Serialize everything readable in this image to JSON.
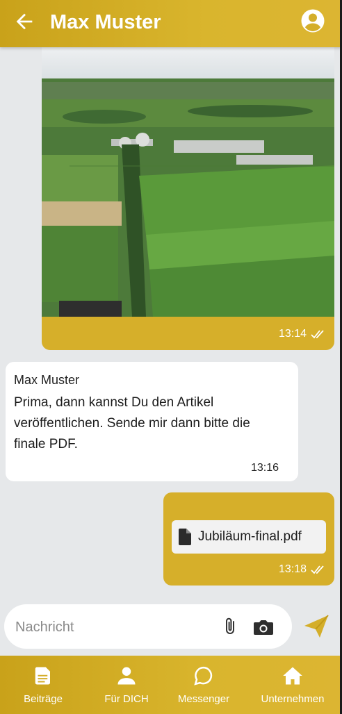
{
  "header": {
    "title": "Max Muster",
    "back_icon": "arrow-left-icon",
    "profile_icon": "account-circle-icon",
    "accent_color": "#d4ae2a"
  },
  "messages": [
    {
      "direction": "outgoing",
      "type": "image",
      "image_description_icon": "aerial-farm-photo",
      "time": "13:14",
      "status_icon": "double-check-icon"
    },
    {
      "direction": "incoming",
      "type": "text",
      "sender": "Max Muster",
      "text": "Prima, dann kannst Du den Artikel veröffentlichen. Sende mir dann bitte die finale PDF.",
      "time": "13:16"
    },
    {
      "direction": "outgoing",
      "type": "file",
      "file_icon": "document-icon",
      "file_name": "Jubiläum-final.pdf",
      "time": "13:18",
      "status_icon": "double-check-icon"
    }
  ],
  "composer": {
    "placeholder": "Nachricht",
    "value": "",
    "attach_icon": "paperclip-icon",
    "camera_icon": "camera-icon",
    "send_icon": "send-icon"
  },
  "bottom_nav": {
    "items": [
      {
        "label": "Beiträge",
        "icon": "article-icon"
      },
      {
        "label": "Für DICH",
        "icon": "person-icon"
      },
      {
        "label": "Messenger",
        "icon": "chat-bubble-icon"
      },
      {
        "label": "Unternehmen",
        "icon": "home-icon"
      }
    ]
  }
}
